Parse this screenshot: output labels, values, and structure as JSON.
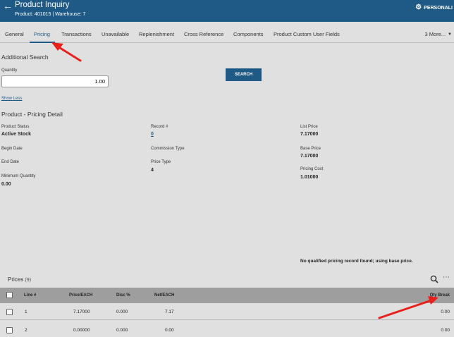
{
  "header": {
    "title": "Product Inquiry",
    "subtitle": "Product: 401015 | Warehouse: 7",
    "personalize_label": "PERSONALI"
  },
  "tabs": [
    {
      "label": "General"
    },
    {
      "label": "Pricing"
    },
    {
      "label": "Transactions"
    },
    {
      "label": "Unavailable"
    },
    {
      "label": "Replenishment"
    },
    {
      "label": "Cross Reference"
    },
    {
      "label": "Components"
    },
    {
      "label": "Product Custom User Fields"
    }
  ],
  "more_tabs_label": "3 More...",
  "additional_search": {
    "title": "Additional Search",
    "quantity_label": "Quantity",
    "quantity_value": "1.00",
    "search_button": "SEARCH",
    "show_less": "Show Less"
  },
  "pricing_detail": {
    "title": "Product - Pricing Detail",
    "product_status_label": "Product Status",
    "product_status_value": "Active Stock",
    "begin_date_label": "Begin Date",
    "end_date_label": "End Date",
    "minimum_quantity_label": "Minimum Quantity",
    "minimum_quantity_value": "0.00",
    "record_label": "Record #",
    "record_value": "0",
    "commission_type_label": "Commission Type",
    "price_type_label": "Price Type",
    "price_type_value": "4",
    "list_price_label": "List Price",
    "list_price_value": "7.17000",
    "base_price_label": "Base Price",
    "base_price_value": "7.17000",
    "pricing_cost_label": "Pricing Cost",
    "pricing_cost_value": "1.01000",
    "notice": "No qualified pricing record found; using base price."
  },
  "prices": {
    "title": "Prices",
    "count": "(9)",
    "columns": [
      "Line #",
      "Price/EACH",
      "Disc %",
      "Net/EACH",
      "Qty Break"
    ],
    "rows": [
      {
        "line": "1",
        "price": "7.17000",
        "disc": "0.000",
        "net": "7.17",
        "qty_break": "0.00"
      },
      {
        "line": "2",
        "price": "0.00000",
        "disc": "0.000",
        "net": "0.00",
        "qty_break": "0.00"
      }
    ]
  },
  "colors": {
    "brand": "#1f5a87",
    "annotation": "#e8201c"
  }
}
